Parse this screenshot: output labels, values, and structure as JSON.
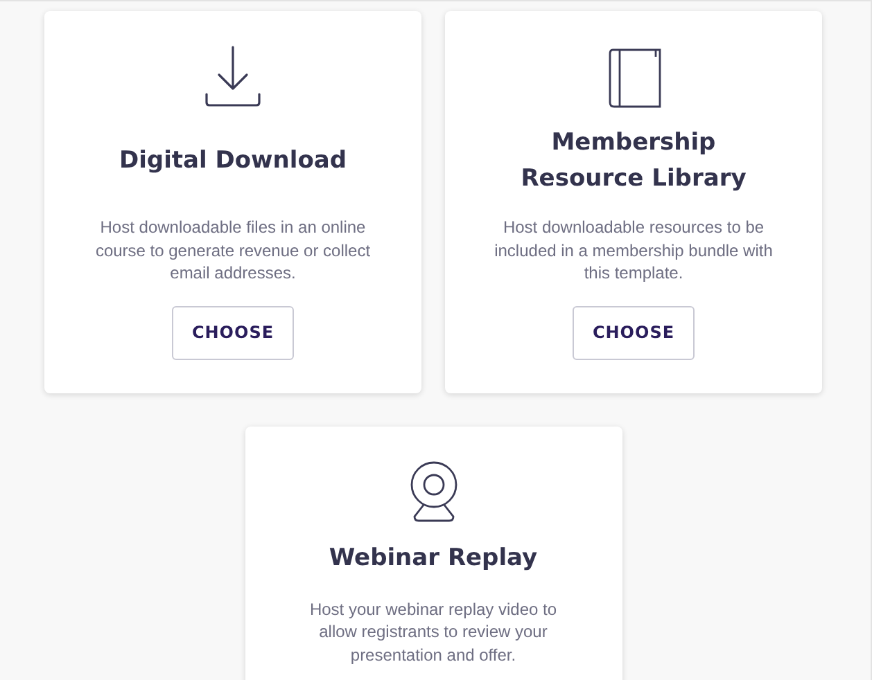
{
  "cards": [
    {
      "title": "Digital Download",
      "description": "Host downloadable files in an online course to generate revenue or collect email addresses.",
      "button": "CHOOSE"
    },
    {
      "title": "Membership Resource Library",
      "description": "Host downloadable resources to be included in a membership bundle with this template.",
      "button": "CHOOSE"
    },
    {
      "title": "Webinar Replay",
      "description": "Host your webinar replay video to allow registrants to review your presentation and offer."
    }
  ]
}
